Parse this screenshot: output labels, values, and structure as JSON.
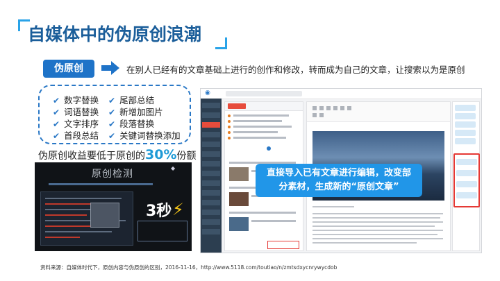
{
  "title": "自媒体中的伪原创浪潮",
  "definition": {
    "badge": "伪原创",
    "text": "在别人已经有的文章基础上进行的创作和修改，转而成为自己的文章，让搜索以为是原创"
  },
  "methods": [
    "数字替换",
    "尾部总结",
    "词语替换",
    "新增加图片",
    "文字排序",
    "段落替换",
    "首段总结",
    "关键词替换添加"
  ],
  "caption": {
    "prefix": "伪原创收益要低于原创的",
    "percent": "30%",
    "suffix": "份额"
  },
  "preview": {
    "heading": "原创检测",
    "seconds": "3秒"
  },
  "callout": {
    "line1": "直接导入已有文章进行编辑，改变部",
    "line2": "分素材，生成新的“原创文章”"
  },
  "source": "资料来源：自媒体时代下，原创内容与伪原创的区别，2016-11-16，http://www.5118.com/toutiao/n/zmtsdxycnrywycdob",
  "colors": {
    "title": "#1b5e9a",
    "accent": "#1e73c8",
    "highlight_blue": "#2196e8",
    "alert_red": "#e53935"
  }
}
